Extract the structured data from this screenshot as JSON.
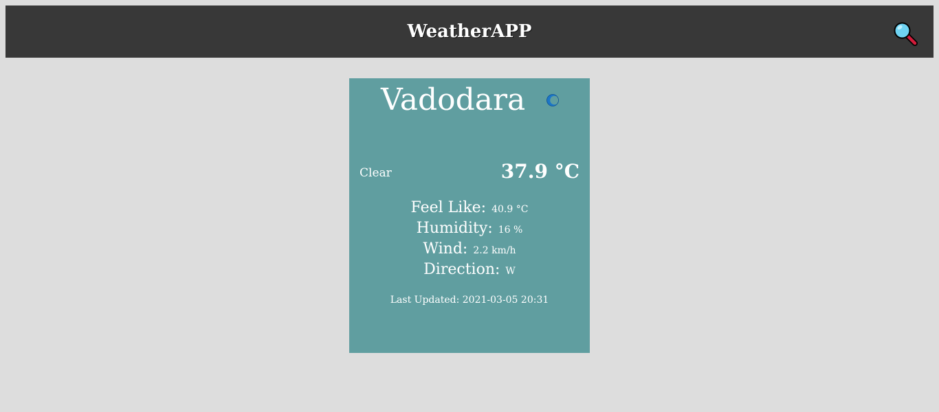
{
  "header": {
    "title": "WeatherAPP",
    "search_icon": "magnifying-glass-icon"
  },
  "weather": {
    "city": "Vadodara",
    "icon": "crescent-moon-icon",
    "condition": "Clear",
    "temperature": "37.9 °C",
    "details": [
      {
        "label": "Feel Like:",
        "value": "40.9 °C"
      },
      {
        "label": "Humidity:",
        "value": "16 %"
      },
      {
        "label": "Wind:",
        "value": "2.2 km/h"
      },
      {
        "label": "Direction:",
        "value": "W"
      }
    ],
    "last_updated": "Last Updated: 2021-03-05 20:31"
  },
  "colors": {
    "page_background": "#dddddd",
    "navbar": "#383838",
    "card": "#609ea0",
    "text": "#ffffff"
  }
}
